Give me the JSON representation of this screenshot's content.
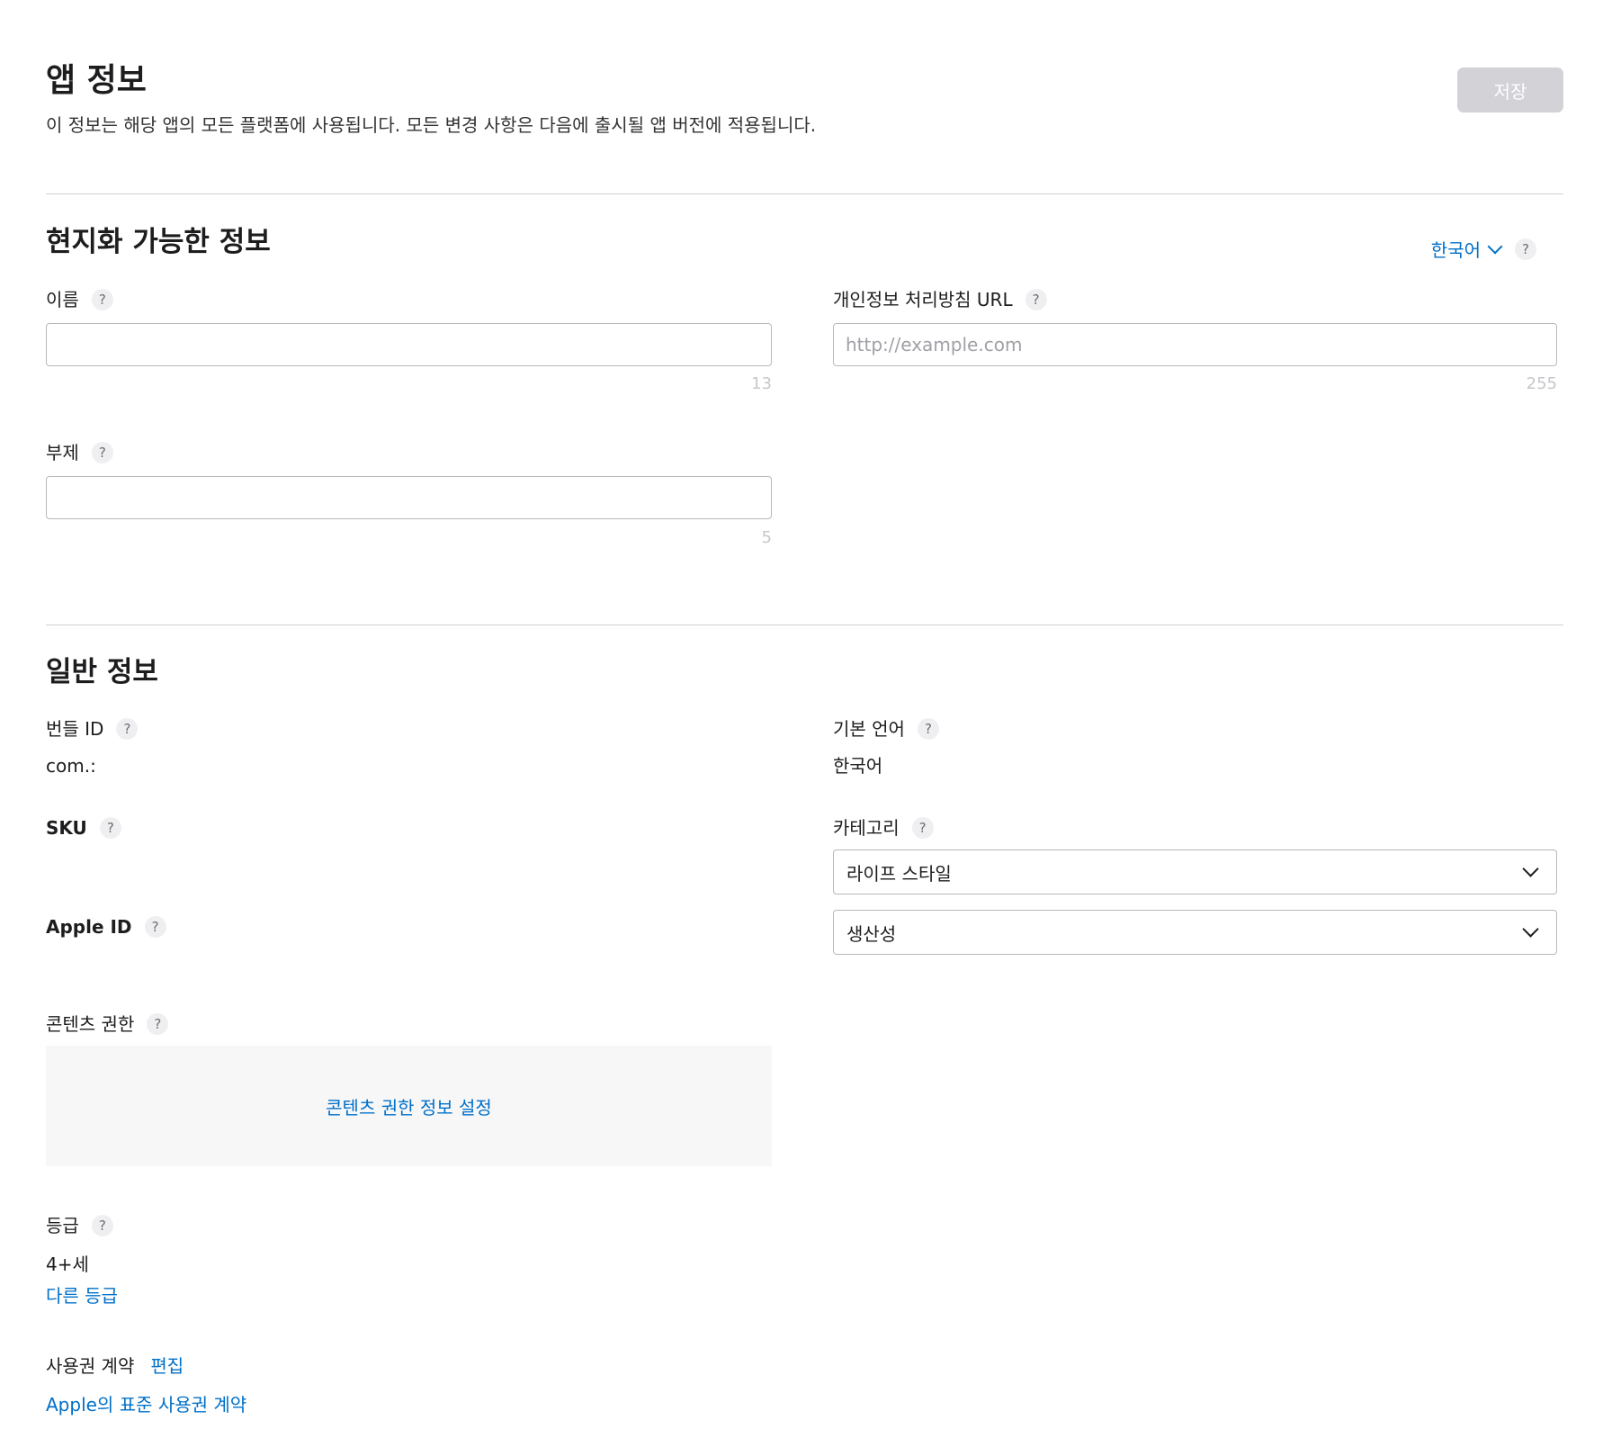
{
  "header": {
    "title": "앱 정보",
    "subtitle": "이 정보는 해당 앱의 모든 플랫폼에 사용됩니다. 모든 변경 사항은 다음에 출시될 앱 버전에 적용됩니다.",
    "save_label": "저장"
  },
  "help_glyph": "?",
  "localizable": {
    "title": "현지화 가능한 정보",
    "language": "한국어",
    "name": {
      "label": "이름",
      "value": "",
      "counter": "13"
    },
    "privacy_url": {
      "label": "개인정보 처리방침 URL",
      "value": "",
      "placeholder": "http://example.com",
      "counter": "255"
    },
    "subtitle": {
      "label": "부제",
      "value": "",
      "counter": "5"
    }
  },
  "general": {
    "title": "일반 정보",
    "bundle_id": {
      "label": "번들 ID",
      "value": "com.:"
    },
    "primary_language": {
      "label": "기본 언어",
      "value": "한국어"
    },
    "sku": {
      "label": "SKU",
      "value": ""
    },
    "category": {
      "label": "카테고리",
      "primary": "라이프 스타일",
      "secondary": "생산성"
    },
    "apple_id": {
      "label": "Apple ID",
      "value": ""
    },
    "content_rights": {
      "label": "콘텐츠 권한",
      "link": "콘텐츠 권한 정보 설정"
    },
    "age_rating": {
      "label": "등급",
      "value": "4+세",
      "link": "다른 등급"
    },
    "license": {
      "label": "사용권 계약",
      "edit_link": "편집",
      "agreement_link": "Apple의 표준 사용권 계약"
    }
  },
  "colors": {
    "accent": "#0070c9",
    "save_disabled": "#d2d2d7",
    "divider": "#d2d2d7"
  }
}
